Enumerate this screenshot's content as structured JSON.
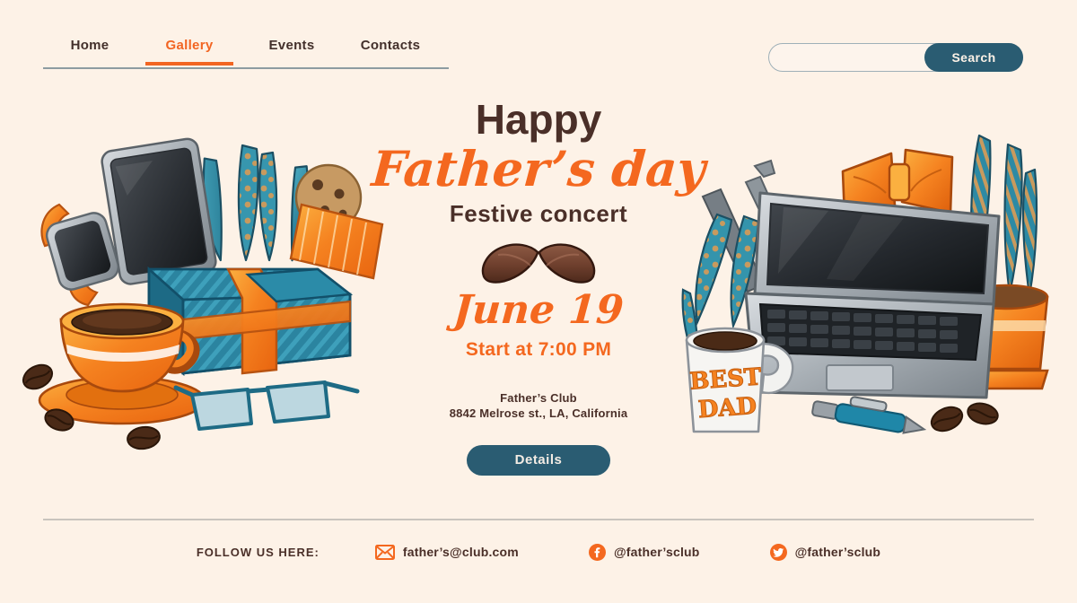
{
  "theme": {
    "background": "#fdf2e7",
    "orange": "#f4681f",
    "teal": "#2a5c72",
    "dark_brown": "#4a2f28",
    "rule_grey": "#c9c4bd"
  },
  "nav": {
    "items": [
      {
        "label": "Home",
        "active": false
      },
      {
        "label": "Gallery",
        "active": true
      },
      {
        "label": "Events",
        "active": false
      },
      {
        "label": "Contacts",
        "active": false
      }
    ]
  },
  "search": {
    "value": "",
    "placeholder": "",
    "button_label": "Search"
  },
  "hero": {
    "greeting": "Happy",
    "title_script": "Father’s day",
    "subtitle": "Festive concert",
    "date": "June 19",
    "time": "Start at 7:00 PM",
    "venue_name": "Father’s Club",
    "venue_address": "8842 Melrose st., LA, California",
    "cta_label": "Details",
    "mustache_icon": "mustache-icon"
  },
  "footer": {
    "follow_label": "FOLLOW US HERE:",
    "links": [
      {
        "icon": "envelope-icon",
        "text": "father’s@club.com"
      },
      {
        "icon": "facebook-icon",
        "text": "@father’sclub"
      },
      {
        "icon": "twitter-icon",
        "text": "@father’sclub"
      }
    ]
  },
  "illustrations": {
    "left": "fathers-day-gift-coffee-tablet-illustration",
    "right": "fathers-day-laptop-best-dad-mug-illustration"
  }
}
